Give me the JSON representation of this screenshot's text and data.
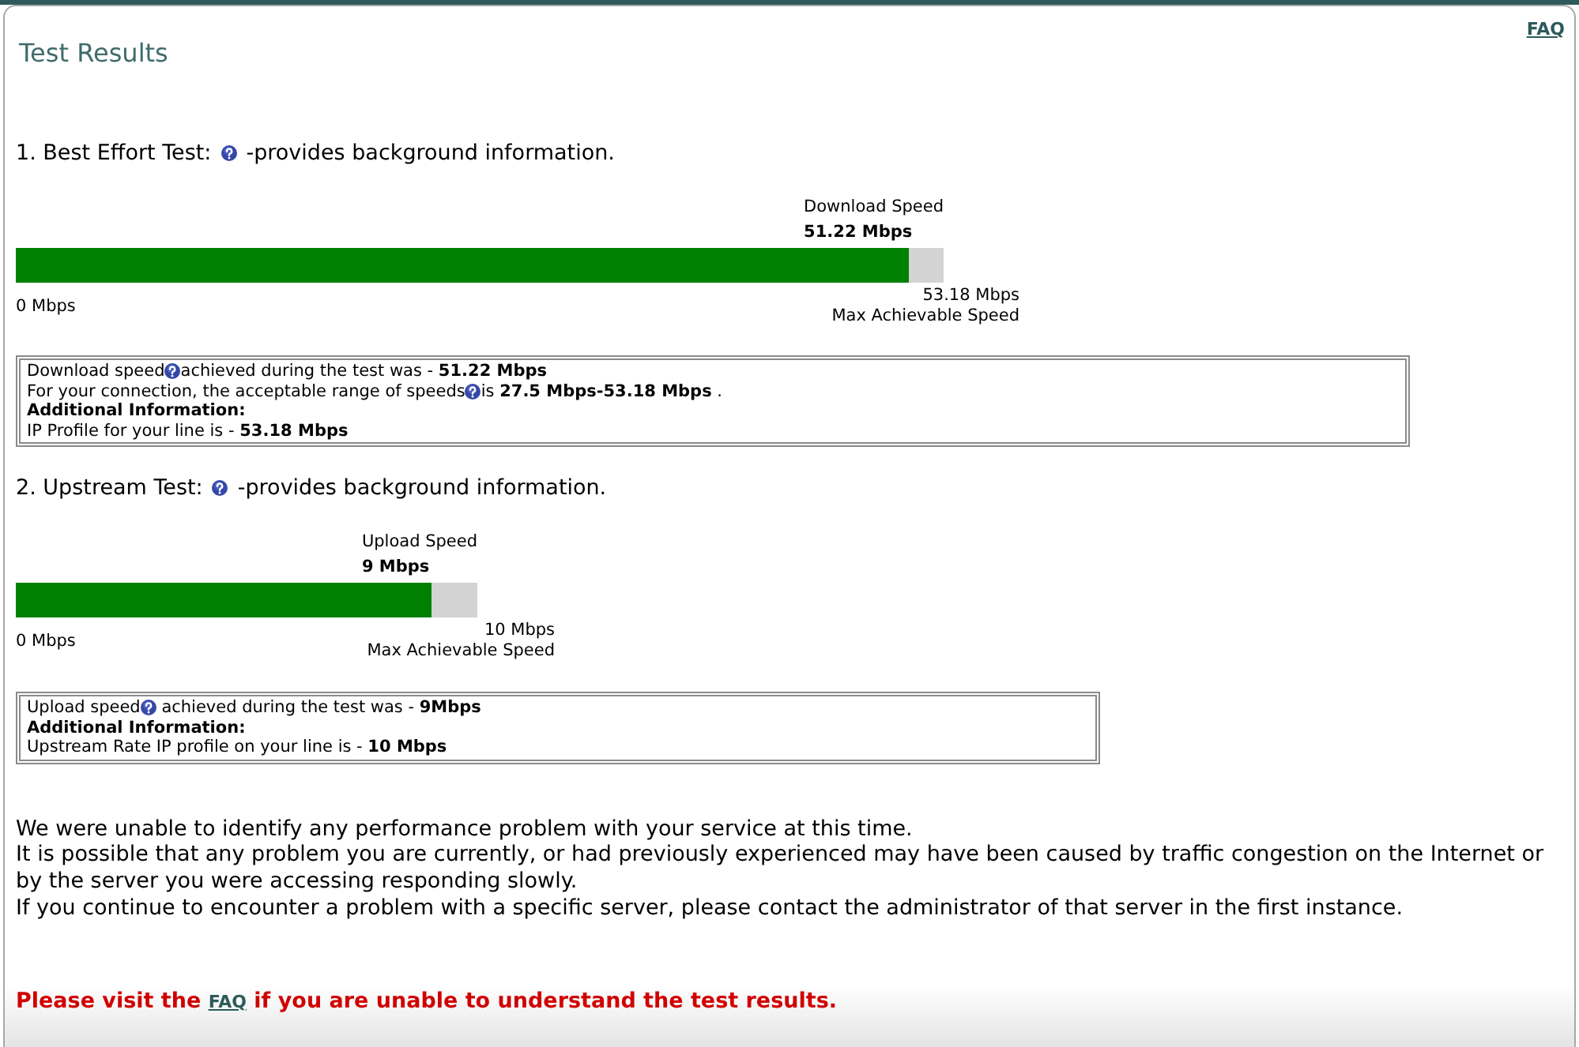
{
  "header": {
    "title": "Test Results",
    "faq_link": "FAQ"
  },
  "tests": [
    {
      "heading": "1. Best Effort Test:",
      "heading_note": "-provides background information.",
      "meter": {
        "label": "Download Speed",
        "reading": "51.22 Mbps",
        "level": 0.963,
        "min_label": "0 Mbps",
        "max_reading": "53.18 Mbps",
        "max_label": "Max Achievable Speed"
      },
      "info_lines": [
        {
          "kind": "help",
          "before": "Download speed",
          "after": "achieved during the test was - **51.22 Mbps**"
        },
        {
          "kind": "help",
          "before": "For your connection, the acceptable range of speeds",
          "after": "is **27.5 Mbps-53.18 Mbps** ."
        },
        {
          "kind": "heading",
          "text": "Additional Information:"
        },
        {
          "kind": "text",
          "text": "IP Profile for your line is - **53.18 Mbps**"
        }
      ]
    },
    {
      "heading": "2. Upstream Test:",
      "heading_note": "-provides background information.",
      "meter": {
        "label": "Upload Speed",
        "reading": "9 Mbps",
        "level": 0.9,
        "min_label": "0 Mbps",
        "max_reading": "10 Mbps",
        "max_label": "Max Achievable Speed"
      },
      "info_lines": [
        {
          "kind": "help",
          "before": "Upload speed",
          "after": " achieved during the test was - **9Mbps**"
        },
        {
          "kind": "heading",
          "text": "Additional Information:"
        },
        {
          "kind": "text",
          "text": "Upstream Rate IP profile on your line is - **10 Mbps**"
        }
      ]
    }
  ],
  "summary": [
    "We were unable to identify any performance problem with your service at this time.",
    "It is possible that any problem you are currently, or had previously experienced may have been caused by traffic congestion on the Internet or by the server you were accessing responding slowly.",
    "If you continue to encounter a problem with a specific server, please contact the administrator of that server in the first instance."
  ],
  "notice": {
    "before": "Please visit the",
    "link": "FAQ",
    "after": "if you are unable to understand the test results."
  }
}
